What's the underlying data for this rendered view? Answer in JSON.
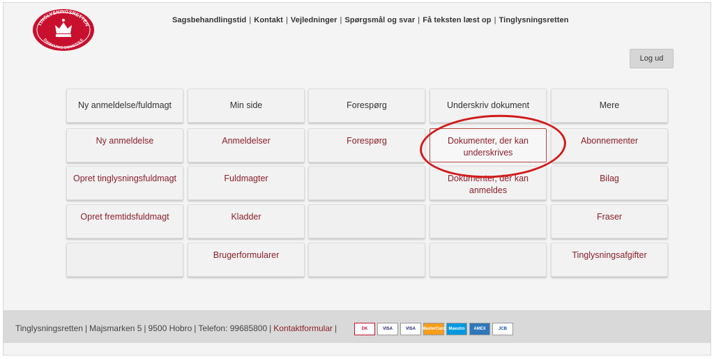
{
  "logo": {
    "top_text": "TINGLYSNINGSRETTEN",
    "bottom_text": "DANMARKS DOMSTOLE",
    "color": "#c8102e"
  },
  "topnav": {
    "items": [
      "Sagsbehandlingstid",
      "Kontakt",
      "Vejledninger",
      "Spørgsmål og svar",
      "Få teksten læst op",
      "Tinglysningsretten"
    ]
  },
  "logout_label": "Log ud",
  "grid": {
    "columns": [
      {
        "header": "Ny anmeldelse/fuldmagt",
        "items": [
          "Ny anmeldelse",
          "Opret tinglysningsfuldmagt",
          "Opret fremtidsfuldmagt",
          ""
        ]
      },
      {
        "header": "Min side",
        "items": [
          "Anmeldelser",
          "Fuldmagter",
          "Kladder",
          "Brugerformularer"
        ]
      },
      {
        "header": "Forespørg",
        "items": [
          "Forespørg",
          "",
          "",
          ""
        ]
      },
      {
        "header": "Underskriv dokument",
        "items": [
          "Dokumenter, der kan underskrives",
          "Dokumenter, der kan anmeldes",
          "",
          ""
        ]
      },
      {
        "header": "Mere",
        "items": [
          "Abonnementer",
          "Bilag",
          "Fraser",
          "Tinglysningsafgifter"
        ]
      }
    ]
  },
  "footer": {
    "name": "Tinglysningsretten",
    "address": "Majsmarken 5",
    "city": "9500 Hobro",
    "phone": "Telefon: 99685800",
    "contact_link": "Kontaktformular",
    "payment_cards": [
      {
        "label": "DK",
        "icon": "dankort-icon"
      },
      {
        "label": "VISA",
        "icon": "visa-icon"
      },
      {
        "label": "VISA",
        "icon": "visa-electron-icon"
      },
      {
        "label": "MasterCard",
        "icon": "mastercard-icon"
      },
      {
        "label": "Maestro",
        "icon": "maestro-icon"
      },
      {
        "label": "AMEX",
        "icon": "amex-icon"
      },
      {
        "label": "JCB",
        "icon": "jcb-icon"
      }
    ]
  },
  "accent_color": "#8a1f2a"
}
